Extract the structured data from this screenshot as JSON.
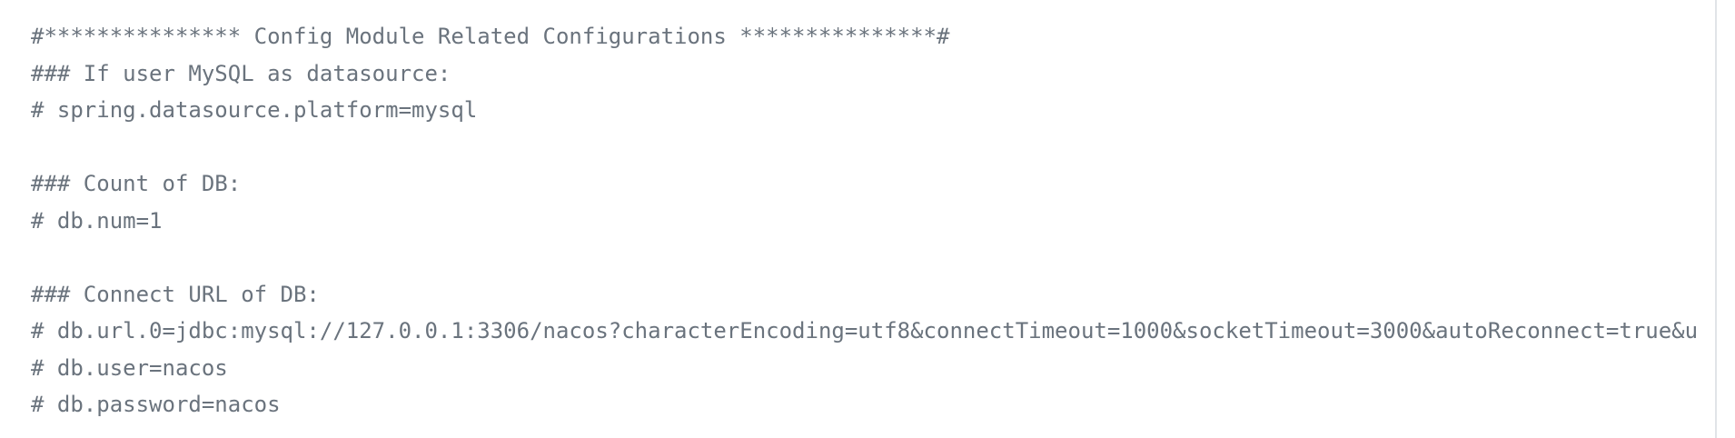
{
  "code": {
    "lines": [
      "#*************** Config Module Related Configurations ***************#",
      "### If user MySQL as datasource:",
      "# spring.datasource.platform=mysql",
      "",
      "### Count of DB:",
      "# db.num=1",
      "",
      "### Connect URL of DB:",
      "# db.url.0=jdbc:mysql://127.0.0.1:3306/nacos?characterEncoding=utf8&connectTimeout=1000&socketTimeout=3000&autoReconnect=true&u",
      "# db.user=nacos",
      "# db.password=nacos"
    ]
  },
  "colors": {
    "text": "#6a737d",
    "background": "#ffffff",
    "divider": "#e1e4e8"
  }
}
